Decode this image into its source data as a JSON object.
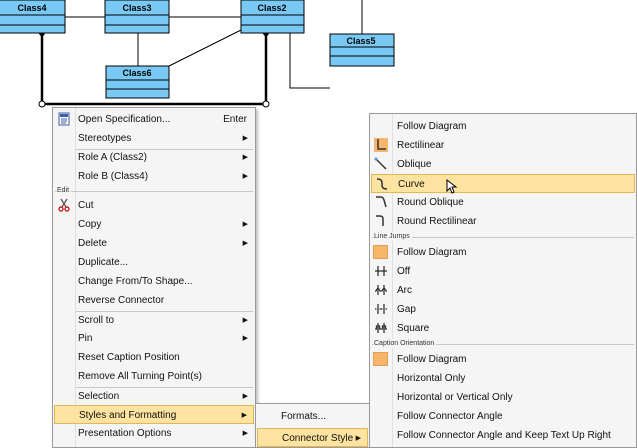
{
  "diagram": {
    "classes": [
      "Class4",
      "Class3",
      "Class2",
      "Class5",
      "Class6"
    ],
    "colors": {
      "fill": "#79c9f4",
      "border": "#000000"
    }
  },
  "context_menu": {
    "items": [
      {
        "label": "Open Specification...",
        "shortcut": "Enter",
        "icon": "specification-icon"
      },
      {
        "label": "Stereotypes",
        "submenu": true
      },
      {
        "label": "Role A (Class2)",
        "submenu": true
      },
      {
        "label": "Role B (Class4)",
        "submenu": true
      },
      {
        "label": "Cut",
        "icon": "scissors-icon"
      },
      {
        "label": "Copy",
        "submenu": true
      },
      {
        "label": "Delete",
        "submenu": true
      },
      {
        "label": "Duplicate..."
      },
      {
        "label": "Change From/To Shape..."
      },
      {
        "label": "Reverse Connector"
      },
      {
        "label": "Scroll to",
        "submenu": true
      },
      {
        "label": "Pin",
        "submenu": true
      },
      {
        "label": "Reset Caption Position"
      },
      {
        "label": "Remove All Turning Point(s)"
      },
      {
        "label": "Selection",
        "submenu": true
      },
      {
        "label": "Styles and Formatting",
        "submenu": true,
        "highlighted": true
      },
      {
        "label": "Presentation Options",
        "submenu": true
      }
    ],
    "section_edit": "Edit"
  },
  "styles_submenu": {
    "items": [
      {
        "label": "Formats..."
      },
      {
        "label": "Connector Style",
        "submenu": true,
        "highlighted": true
      }
    ]
  },
  "connector_submenu": {
    "items": [
      {
        "label": "Follow Diagram"
      },
      {
        "label": "Rectilinear",
        "icon": "rectilinear-icon"
      },
      {
        "label": "Oblique",
        "icon": "oblique-icon"
      },
      {
        "label": "Curve",
        "icon": "curve-icon",
        "highlighted": true
      },
      {
        "label": "Round Oblique",
        "icon": "round-oblique-icon"
      },
      {
        "label": "Round Rectilinear",
        "icon": "round-rectilinear-icon"
      }
    ],
    "line_jumps_header": "Line Jumps",
    "line_jumps": [
      {
        "label": "Follow Diagram"
      },
      {
        "label": "Off",
        "icon": "jump-off-icon"
      },
      {
        "label": "Arc",
        "icon": "jump-arc-icon"
      },
      {
        "label": "Gap",
        "icon": "jump-gap-icon"
      },
      {
        "label": "Square",
        "icon": "jump-square-icon"
      }
    ],
    "caption_header": "Caption Orientation",
    "caption": [
      {
        "label": "Follow Diagram"
      },
      {
        "label": "Horizontal Only"
      },
      {
        "label": "Horizontal or Vertical Only"
      },
      {
        "label": "Follow Connector Angle"
      },
      {
        "label": "Follow Connector Angle and Keep Text Up Right"
      }
    ]
  }
}
